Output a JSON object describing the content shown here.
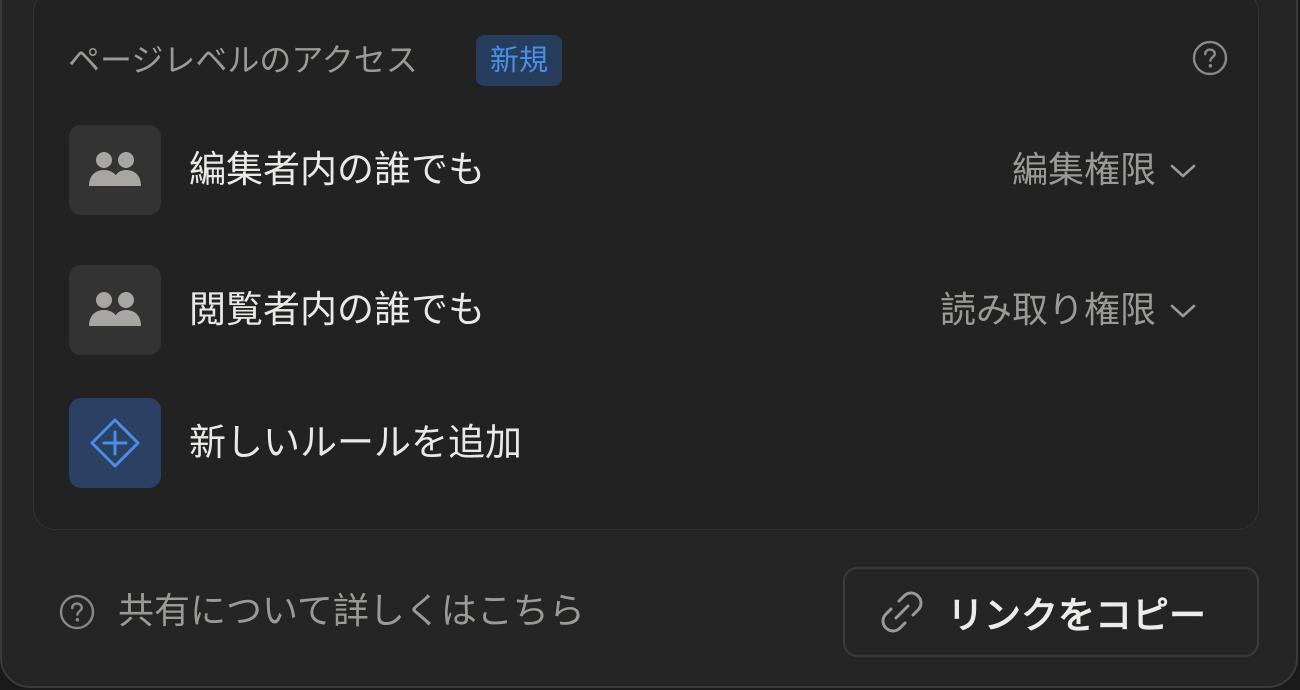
{
  "section": {
    "title": "ページレベルのアクセス",
    "badge": "新規"
  },
  "rows": [
    {
      "icon": "people-icon",
      "label": "編集者内の誰でも",
      "permission": "編集権限"
    },
    {
      "icon": "people-icon",
      "label": "閲覧者内の誰でも",
      "permission": "読み取り権限"
    }
  ],
  "add_rule": {
    "icon": "diamond-plus-icon",
    "label": "新しいルールを追加"
  },
  "footer": {
    "learn_more": "共有について詳しくはこちら",
    "copy_link": "リンクをコピー"
  },
  "colors": {
    "background": "#252525",
    "text_primary": "#e9e9e7",
    "text_secondary": "#9b9a97",
    "accent": "#4a8fe7",
    "badge_bg": "#263d5d"
  }
}
